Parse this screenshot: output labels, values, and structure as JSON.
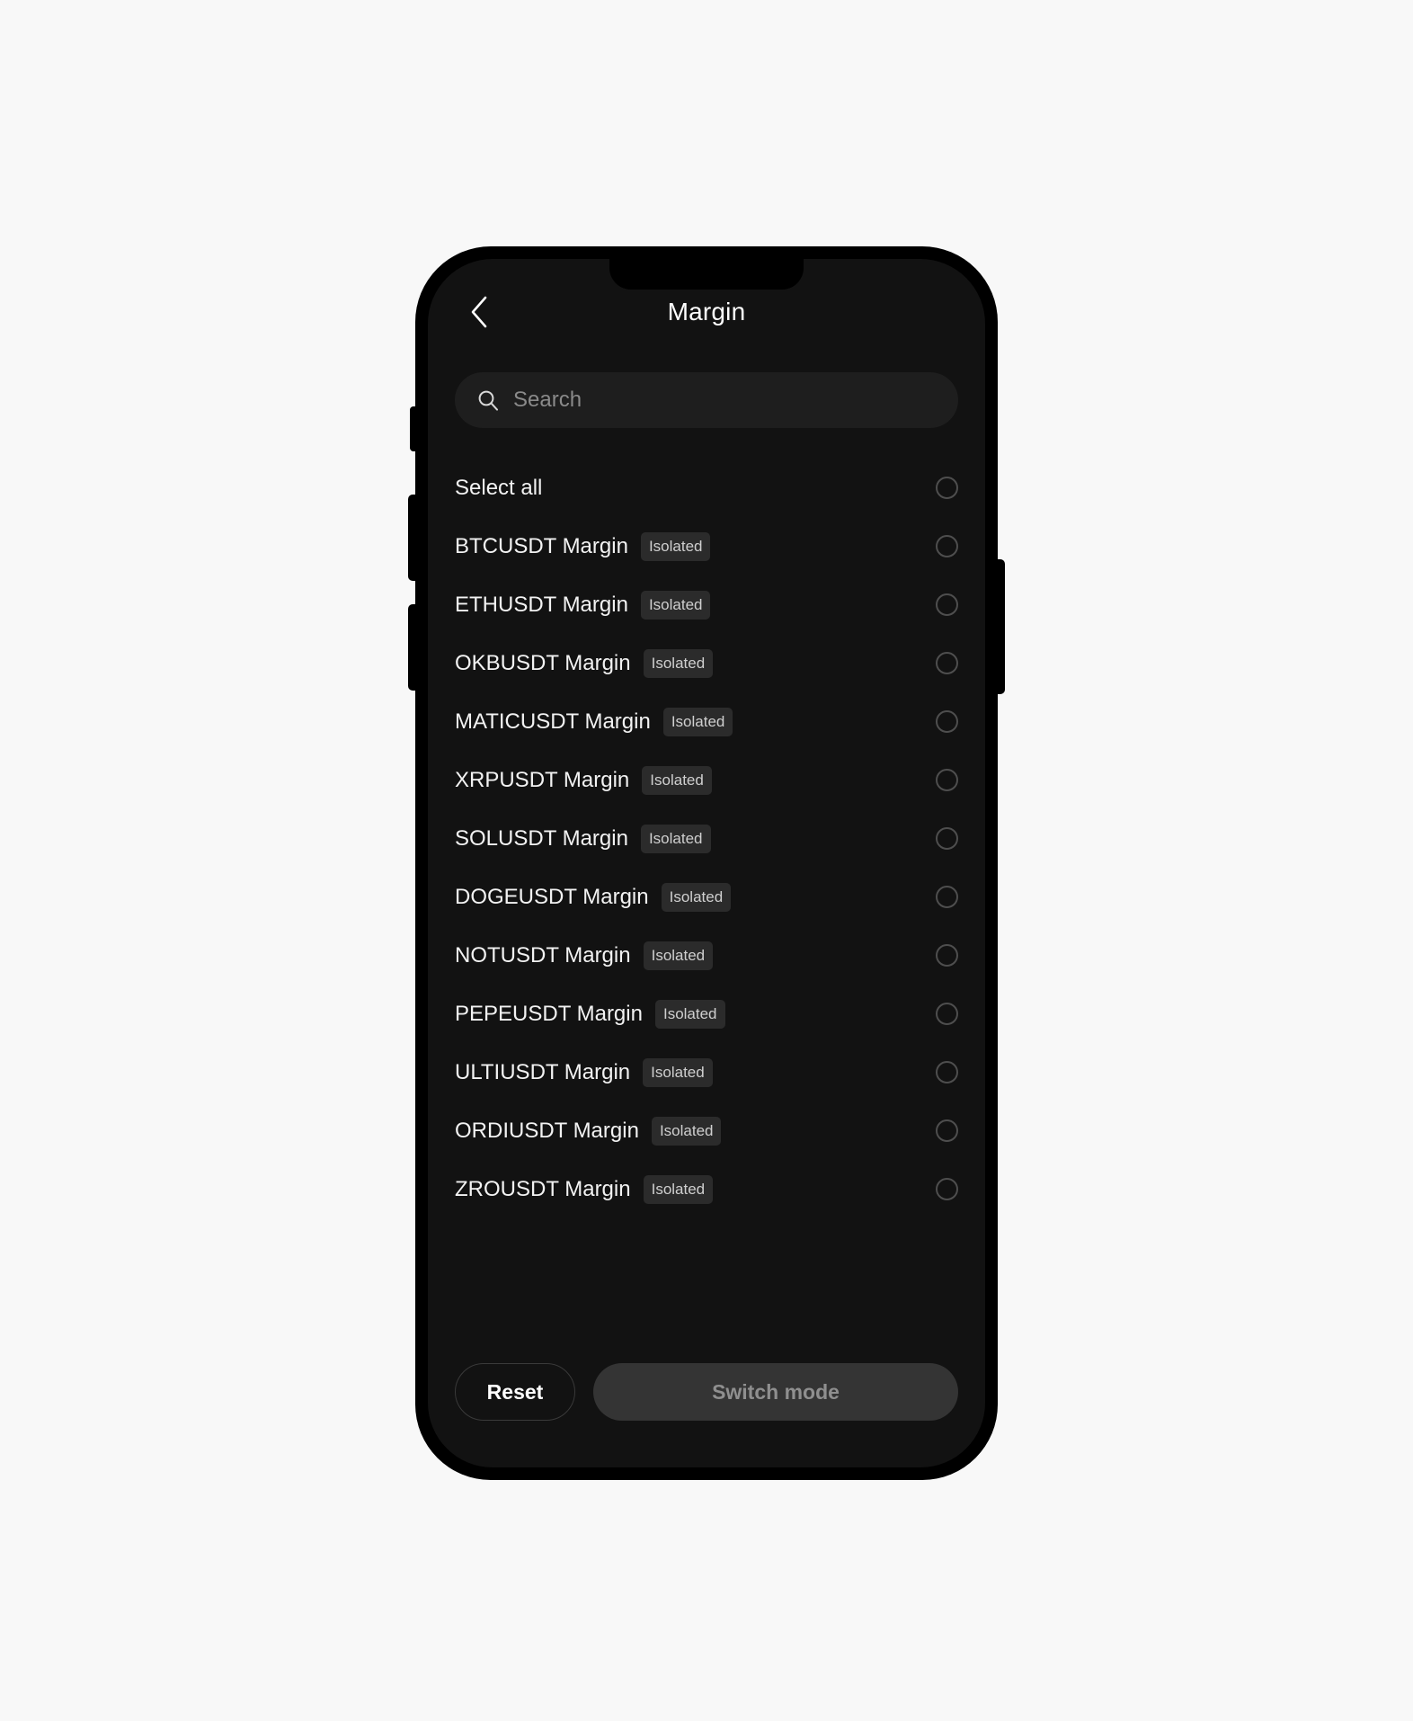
{
  "nav": {
    "title": "Margin",
    "back_icon": "chevron-left-icon"
  },
  "search": {
    "placeholder": "Search",
    "value": "",
    "icon": "search-icon"
  },
  "select_all": {
    "label": "Select all",
    "selected": false
  },
  "list": {
    "badge_label": "Isolated",
    "items": [
      {
        "label": "BTCUSDT Margin",
        "badge": "Isolated",
        "selected": false
      },
      {
        "label": "ETHUSDT Margin",
        "badge": "Isolated",
        "selected": false
      },
      {
        "label": "OKBUSDT Margin",
        "badge": "Isolated",
        "selected": false
      },
      {
        "label": "MATICUSDT Margin",
        "badge": "Isolated",
        "selected": false
      },
      {
        "label": "XRPUSDT Margin",
        "badge": "Isolated",
        "selected": false
      },
      {
        "label": "SOLUSDT Margin",
        "badge": "Isolated",
        "selected": false
      },
      {
        "label": "DOGEUSDT Margin",
        "badge": "Isolated",
        "selected": false
      },
      {
        "label": "NOTUSDT Margin",
        "badge": "Isolated",
        "selected": false
      },
      {
        "label": "PEPEUSDT Margin",
        "badge": "Isolated",
        "selected": false
      },
      {
        "label": "ULTIUSDT Margin",
        "badge": "Isolated",
        "selected": false
      },
      {
        "label": "ORDIUSDT Margin",
        "badge": "Isolated",
        "selected": false
      },
      {
        "label": "ZROUSDT Margin",
        "badge": "Isolated",
        "selected": false
      }
    ]
  },
  "footer": {
    "reset_label": "Reset",
    "switch_label": "Switch mode",
    "switch_disabled": true
  },
  "colors": {
    "page_background": "#f8f8f8",
    "frame": "#000000",
    "screen_background": "#121212",
    "surface": "#1e1e1e",
    "badge_background": "#2b2b2b",
    "badge_text": "#cfcfcf",
    "text_primary": "#f2f2f2",
    "text_muted": "#8a8a8a",
    "radio_border": "#4e4e4e",
    "switch_button_background": "#343434",
    "switch_button_text": "#8f8f8f"
  }
}
